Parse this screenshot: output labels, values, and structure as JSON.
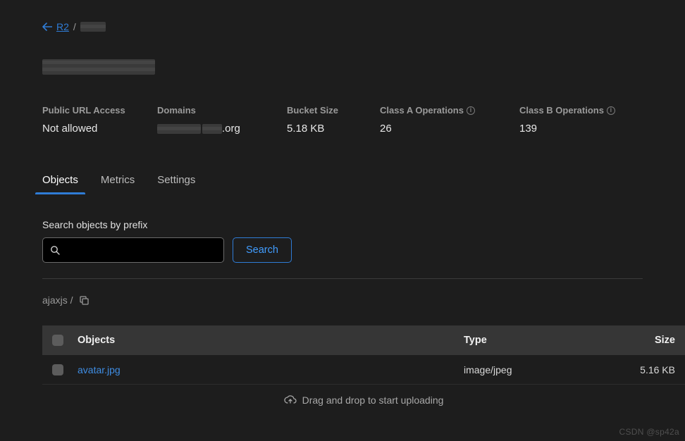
{
  "breadcrumb": {
    "back_label": "R2",
    "separator": "/"
  },
  "stats": {
    "public_url_label": "Public URL Access",
    "public_url_value": "Not allowed",
    "domains_label": "Domains",
    "domains_suffix": ".org",
    "bucket_size_label": "Bucket Size",
    "bucket_size_value": "5.18 KB",
    "class_a_label": "Class A Operations",
    "class_a_value": "26",
    "class_b_label": "Class B Operations",
    "class_b_value": "139"
  },
  "tabs": {
    "objects": "Objects",
    "metrics": "Metrics",
    "settings": "Settings"
  },
  "search": {
    "label": "Search objects by prefix",
    "button": "Search",
    "placeholder": ""
  },
  "path": {
    "current": "ajaxjs /"
  },
  "table": {
    "headers": {
      "objects": "Objects",
      "type": "Type",
      "size": "Size"
    },
    "rows": [
      {
        "name": "avatar.jpg",
        "type": "image/jpeg",
        "size": "5.16 KB"
      }
    ],
    "dropzone": "Drag and drop to start uploading"
  },
  "watermark": "CSDN @sp42a"
}
